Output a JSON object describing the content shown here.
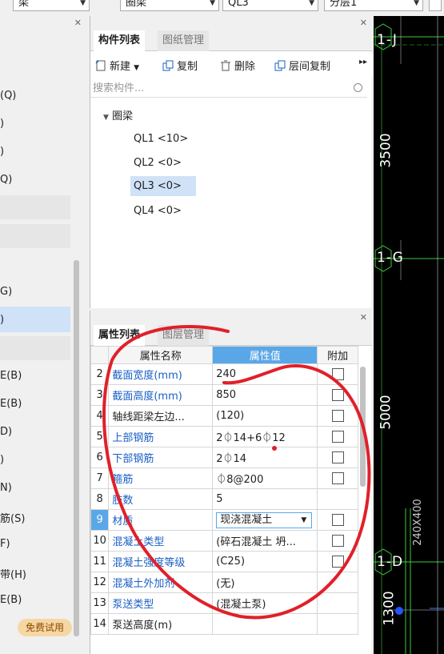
{
  "topbar": {
    "sel1": "梁",
    "sel2": "圈梁",
    "sel3": "QL3",
    "sel4": "分层1"
  },
  "left_panel": {
    "items": [
      "(Q)",
      ")",
      ")",
      "Q)",
      "G)",
      ")",
      "E(B)",
      "E(B)",
      "D)",
      ")",
      "N)",
      "筋(S)",
      "F)",
      "带(H)",
      "E(B)"
    ],
    "trial_badge": "免费试用"
  },
  "component_panel": {
    "tabs": [
      "构件列表",
      "图纸管理"
    ],
    "toolbar": {
      "new": "新建",
      "copy": "复制",
      "delete": "删除",
      "floor_copy": "层间复制"
    },
    "search_placeholder": "搜索构件...",
    "tree": {
      "root": "圈梁",
      "children": [
        "QL1 <10>",
        "QL2 <0>",
        "QL3 <0>",
        "QL4 <0>"
      ]
    },
    "selected": "QL3 <0>"
  },
  "property_panel": {
    "tabs": [
      "属性列表",
      "图层管理"
    ],
    "columns": [
      "属性名称",
      "属性值",
      "附加"
    ],
    "rows": [
      {
        "no": "2",
        "name": "截面宽度(mm)",
        "value": "240"
      },
      {
        "no": "3",
        "name": "截面高度(mm)",
        "value": "850"
      },
      {
        "no": "4",
        "name": "轴线距梁左边...",
        "value": "(120)"
      },
      {
        "no": "5",
        "name": "上部钢筋",
        "value": "2⏀14+6⏀12"
      },
      {
        "no": "6",
        "name": "下部钢筋",
        "value": "2⏀14"
      },
      {
        "no": "7",
        "name": "箍筋",
        "value": "⏀8@200"
      },
      {
        "no": "8",
        "name": "肢数",
        "value": "5"
      },
      {
        "no": "9",
        "name": "材质",
        "value": "现浇混凝土"
      },
      {
        "no": "10",
        "name": "混凝土类型",
        "value": "(碎石混凝土 坍..."
      },
      {
        "no": "11",
        "name": "混凝土强度等级",
        "value": "(C25)"
      },
      {
        "no": "12",
        "name": "混凝土外加剂",
        "value": "(无)"
      },
      {
        "no": "13",
        "name": "泵送类型",
        "value": "(混凝土泵)"
      },
      {
        "no": "14",
        "name": "泵送高度(m)",
        "value": ""
      }
    ]
  },
  "cad": {
    "axis_j": "1-J",
    "dim_3500": "3500",
    "axis_g": "1-G",
    "dim_5000": "5000",
    "beam_label": "240X400",
    "axis_d": "1-D",
    "dim_1300": "1300"
  },
  "colors": {
    "accent": "#5aa7e8",
    "link": "#1a5fc4",
    "annotation": "#e0202a"
  }
}
